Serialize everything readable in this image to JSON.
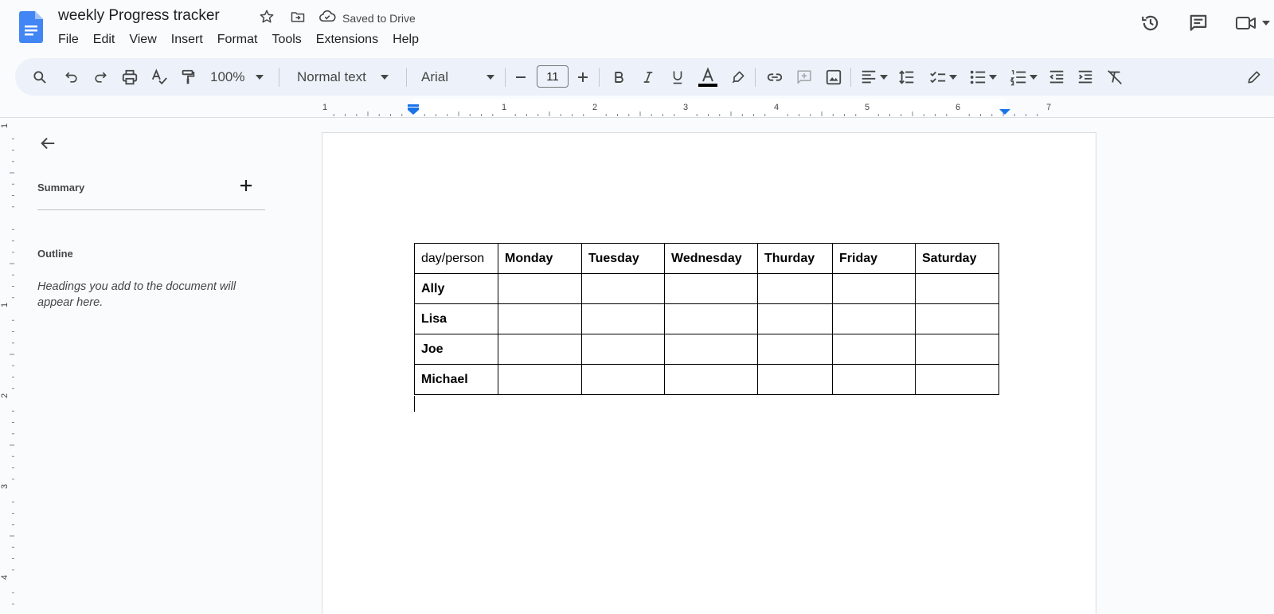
{
  "document": {
    "title": "weekly Progress tracker",
    "save_status": "Saved to Drive"
  },
  "menu": [
    "File",
    "Edit",
    "View",
    "Insert",
    "Format",
    "Tools",
    "Extensions",
    "Help"
  ],
  "toolbar": {
    "zoom": "100%",
    "style": "Normal text",
    "font": "Arial",
    "font_size": "11"
  },
  "ruler": {
    "horizontal_labels": [
      "1",
      "1",
      "2",
      "3",
      "4",
      "5",
      "6",
      "7"
    ],
    "vertical_labels": [
      "1",
      "1",
      "2",
      "3",
      "4"
    ]
  },
  "sidebar": {
    "summary_label": "Summary",
    "outline_label": "Outline",
    "outline_hint": "Headings you add to the document will appear here."
  },
  "table": {
    "header": [
      "day/person",
      "Monday",
      "Tuesday",
      "Wednesday",
      "Thurday",
      "Friday",
      "Saturday"
    ],
    "rows": [
      [
        "Ally",
        "",
        "",
        "",
        "",
        "",
        ""
      ],
      [
        "Lisa",
        "",
        "",
        "",
        "",
        "",
        ""
      ],
      [
        "Joe",
        "",
        "",
        "",
        "",
        "",
        ""
      ],
      [
        "Michael",
        "",
        "",
        "",
        "",
        "",
        ""
      ]
    ]
  },
  "colors": {
    "docs_blue": "#4285f4",
    "toolbar_bg": "#edf2fa",
    "ruler_marker": "#1a73e8"
  }
}
